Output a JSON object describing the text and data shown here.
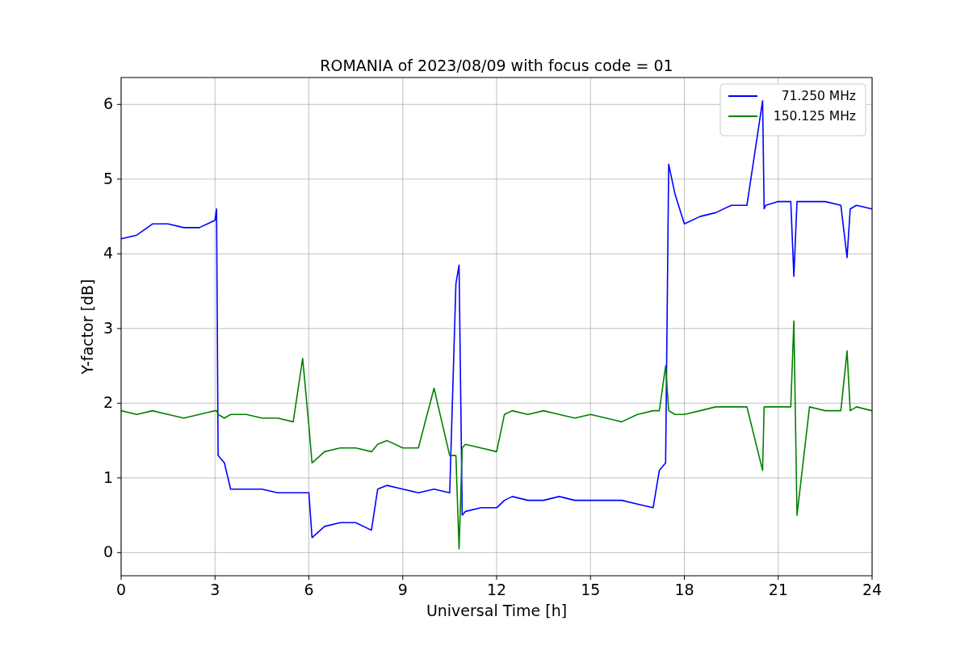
{
  "chart_data": {
    "type": "line",
    "title": "ROMANIA of 2023/08/09 with focus code = 01",
    "xlabel": "Universal Time [h]",
    "ylabel": "Y-factor [dB]",
    "xlim": [
      0,
      24
    ],
    "ylim": [
      -0.31,
      6.36
    ],
    "xticks": [
      0,
      3,
      6,
      9,
      12,
      15,
      18,
      21,
      24
    ],
    "yticks": [
      0,
      1,
      2,
      3,
      4,
      5,
      6
    ],
    "grid": true,
    "legend": true,
    "x": [
      0,
      0.5,
      1,
      1.5,
      2,
      2.5,
      3,
      3.05,
      3.1,
      3.3,
      3.5,
      4,
      4.5,
      5,
      5.5,
      5.8,
      6,
      6.1,
      6.5,
      7,
      7.5,
      8,
      8.2,
      8.5,
      9,
      9.5,
      10,
      10.5,
      10.7,
      10.8,
      10.9,
      11,
      11.5,
      12,
      12.25,
      12.5,
      13,
      13.5,
      14,
      14.5,
      15,
      15.5,
      16,
      16.5,
      17,
      17.2,
      17.4,
      17.5,
      17.7,
      18,
      18.5,
      19,
      19.5,
      20,
      20.5,
      20.55,
      20.6,
      21,
      21.4,
      21.5,
      21.6,
      22,
      22.5,
      23,
      23.2,
      23.3,
      23.5,
      24
    ],
    "series": [
      {
        "name": "71.250 MHz",
        "color": "#0000ff",
        "values": [
          4.2,
          4.25,
          4.4,
          4.4,
          4.35,
          4.35,
          4.45,
          4.6,
          1.3,
          1.2,
          0.85,
          0.85,
          0.85,
          0.8,
          0.8,
          0.8,
          0.8,
          0.2,
          0.35,
          0.4,
          0.4,
          0.3,
          0.85,
          0.9,
          0.85,
          0.8,
          0.85,
          0.8,
          3.6,
          3.85,
          0.5,
          0.55,
          0.6,
          0.6,
          0.7,
          0.75,
          0.7,
          0.7,
          0.75,
          0.7,
          0.7,
          0.7,
          0.7,
          0.65,
          0.6,
          1.1,
          1.2,
          5.2,
          4.8,
          4.4,
          4.5,
          4.55,
          4.65,
          4.65,
          6.05,
          4.6,
          4.65,
          4.7,
          4.7,
          3.7,
          4.7,
          4.7,
          4.7,
          4.65,
          3.95,
          4.6,
          4.65,
          4.6
        ]
      },
      {
        "name": "150.125 MHz",
        "color": "#008000",
        "values": [
          1.9,
          1.85,
          1.9,
          1.85,
          1.8,
          1.85,
          1.9,
          1.9,
          1.85,
          1.8,
          1.85,
          1.85,
          1.8,
          1.8,
          1.75,
          2.6,
          1.7,
          1.2,
          1.35,
          1.4,
          1.4,
          1.35,
          1.45,
          1.5,
          1.4,
          1.4,
          2.2,
          1.3,
          1.3,
          0.05,
          1.4,
          1.45,
          1.4,
          1.35,
          1.85,
          1.9,
          1.85,
          1.9,
          1.85,
          1.8,
          1.85,
          1.8,
          1.75,
          1.85,
          1.9,
          1.9,
          2.5,
          1.9,
          1.85,
          1.85,
          1.9,
          1.95,
          1.95,
          1.95,
          1.1,
          1.95,
          1.95,
          1.95,
          1.95,
          3.1,
          0.5,
          1.95,
          1.9,
          1.9,
          2.7,
          1.9,
          1.95,
          1.9
        ]
      }
    ]
  }
}
